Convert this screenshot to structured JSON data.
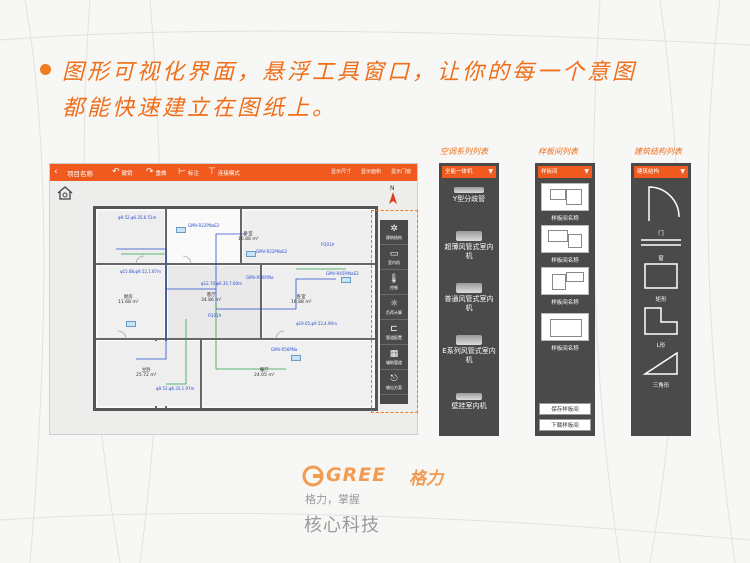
{
  "headline": {
    "line1": "图形可视化界面，悬浮工具窗口，让你的每一个意图",
    "line2": "都能快速建立在图纸上。"
  },
  "app": {
    "back_icon": "chevron-left-icon",
    "title": "项目名称",
    "tools": [
      {
        "icon": "undo-icon",
        "label": "撤销"
      },
      {
        "icon": "redo-icon",
        "label": "重做"
      },
      {
        "icon": "dimension-icon",
        "label": "标注"
      },
      {
        "icon": "paste-icon",
        "label": "连接模式"
      }
    ],
    "right_tools": [
      "显示尺寸",
      "显示面积",
      "显示门窗"
    ],
    "side_tools": [
      {
        "icon": "fan-icon",
        "label": "建筑结构"
      },
      {
        "icon": "indoor-unit-icon",
        "label": "室内机"
      },
      {
        "icon": "thermometer-icon",
        "label": "控制"
      },
      {
        "icon": "sun-icon",
        "label": "负荷计算"
      },
      {
        "icon": "pipe-icon",
        "label": "管道配置"
      },
      {
        "icon": "grid-icon",
        "label": "辅助管道"
      },
      {
        "icon": "export-icon",
        "label": "输出方案"
      }
    ],
    "rooms": [
      {
        "name": "卧室",
        "area": "16.88 m²"
      },
      {
        "name": "厨房",
        "area": "11.68 m²"
      },
      {
        "name": "客厅",
        "area": "34.86 m²"
      },
      {
        "name": "卧室",
        "area": "16.88 m²"
      },
      {
        "name": "主卧",
        "area": "25.72 m²"
      },
      {
        "name": "餐厅",
        "area": "24.05 m²"
      }
    ],
    "units": [
      "GMV-R22PNaE2",
      "GMV-R22PNaE2",
      "GMV-R45P/NaE2",
      "GMV-R56P/Na",
      "GMV-R56PNa"
    ],
    "pipe_labels": [
      "φ9.52,φ6.35,6.51m",
      "φ15.88,φ9.52,1.87m",
      "φ12.70,φ6.35,7.60m",
      "φ19.05,φ9.52,4.90m",
      "φ9.52,φ6.35,1.97m"
    ],
    "joints": [
      "FQ01A",
      "FQ01A"
    ]
  },
  "panels": {
    "ac": {
      "title": "空调系列列表",
      "select": "全能一体机",
      "items": [
        "Y型分歧管",
        "超薄风管式室内机",
        "普通风管式室内机",
        "E系列风管式室内机",
        "壁挂室内机"
      ]
    },
    "samples": {
      "title": "样板间列表",
      "select": "样板间",
      "names": [
        "样板间名称",
        "样板间名称",
        "样板间名称",
        "样板间名称"
      ],
      "save_label": "保存样板间",
      "download_label": "下载样板间"
    },
    "structure": {
      "title": "建筑结构列表",
      "select": "建筑结构",
      "shapes": [
        "门",
        "窗",
        "矩形",
        "L形",
        "三角形"
      ]
    }
  },
  "logo": {
    "brand": "GREE",
    "brand_cn": "格力",
    "slogan": "格力，掌握",
    "core": "核心科技"
  },
  "colors": {
    "accent": "#f05a1e",
    "heading": "#ef6e1a",
    "panel": "#4a4a4a",
    "pipe": "#2a4fd1"
  }
}
